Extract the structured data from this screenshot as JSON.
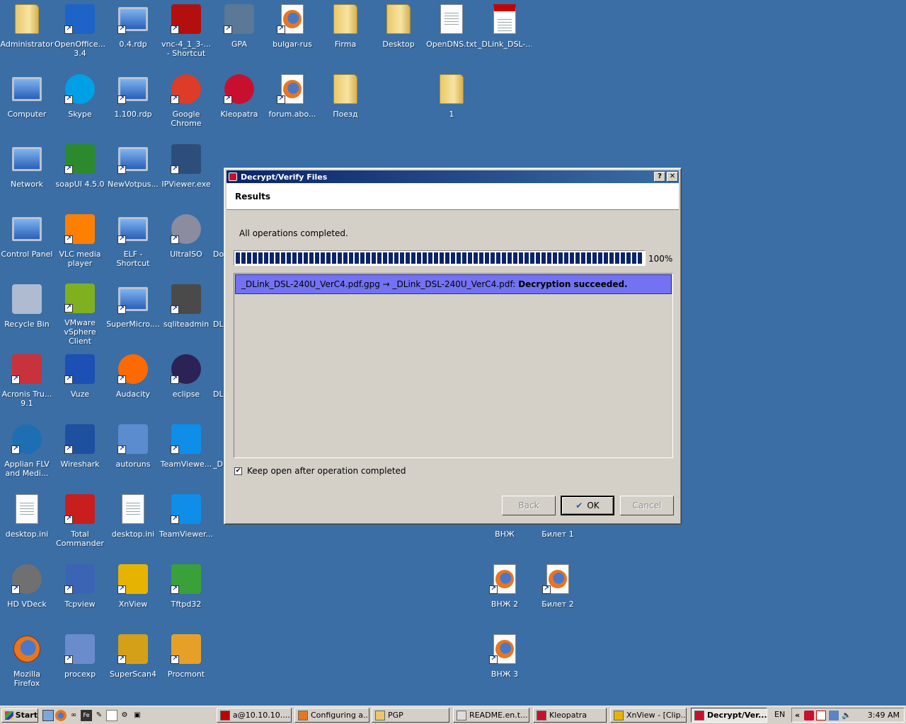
{
  "desktop": {
    "icons": [
      {
        "label": "Administrator",
        "icon": "user-folder-icon",
        "shortcut": false
      },
      {
        "label": "OpenOffice...\n3.4",
        "icon": "openoffice-icon",
        "shortcut": true
      },
      {
        "label": "0.4.rdp",
        "icon": "remote-desktop-icon",
        "shortcut": true
      },
      {
        "label": "vnc-4_1_3-...\n- Shortcut",
        "icon": "vnc-icon",
        "shortcut": true
      },
      {
        "label": "GPA",
        "icon": "gpa-keys-icon",
        "shortcut": true
      },
      {
        "label": "bulgar-rus",
        "icon": "firefox-document-icon",
        "shortcut": true
      },
      {
        "label": "Firma",
        "icon": "folder-icon",
        "shortcut": false
      },
      {
        "label": "Desktop",
        "icon": "folder-warning-icon",
        "shortcut": false
      },
      {
        "label": "OpenDNS.txt",
        "icon": "text-file-icon",
        "shortcut": false
      },
      {
        "label": "_DLink_DSL-...",
        "icon": "pdf-file-icon",
        "shortcut": false
      },
      {
        "label": "Computer",
        "icon": "computer-icon",
        "shortcut": false
      },
      {
        "label": "Skype",
        "icon": "skype-icon",
        "shortcut": true
      },
      {
        "label": "1.100.rdp",
        "icon": "remote-desktop-icon",
        "shortcut": true
      },
      {
        "label": "Google\nChrome",
        "icon": "chrome-icon",
        "shortcut": true
      },
      {
        "label": "Kleopatra",
        "icon": "kleopatra-icon",
        "shortcut": true
      },
      {
        "label": "forum.abo...",
        "icon": "firefox-document-icon",
        "shortcut": true
      },
      {
        "label": "Поезд",
        "icon": "folder-icon",
        "shortcut": false
      },
      {
        "label": "1",
        "icon": "folder-icon",
        "shortcut": false
      },
      {
        "label": "Network",
        "icon": "network-icon",
        "shortcut": false
      },
      {
        "label": "soapUI 4.5.0",
        "icon": "soapui-icon",
        "shortcut": true
      },
      {
        "label": "NewVotpus...",
        "icon": "remote-desktop-icon",
        "shortcut": true
      },
      {
        "label": "IPViewer.exe",
        "icon": "kvm-icon",
        "shortcut": true
      },
      {
        "label": "Control Panel",
        "icon": "control-panel-icon",
        "shortcut": false
      },
      {
        "label": "VLC media\nplayer",
        "icon": "vlc-icon",
        "shortcut": true
      },
      {
        "label": "ELF - Shortcut",
        "icon": "network-computers-icon",
        "shortcut": true
      },
      {
        "label": "UltraISO",
        "icon": "disc-icon",
        "shortcut": true
      },
      {
        "label": "Recycle Bin",
        "icon": "recycle-bin-icon",
        "shortcut": false
      },
      {
        "label": "VMware\nvSphere Client",
        "icon": "vmware-icon",
        "shortcut": true
      },
      {
        "label": "SuperMicro....",
        "icon": "remote-desktop-icon",
        "shortcut": true
      },
      {
        "label": "sqliteadmin",
        "icon": "sqlite-icon",
        "shortcut": true
      },
      {
        "label": "Acronis Tru...\n9.1",
        "icon": "acronis-icon",
        "shortcut": true
      },
      {
        "label": "Vuze",
        "icon": "vuze-icon",
        "shortcut": true
      },
      {
        "label": "Audacity",
        "icon": "audacity-icon",
        "shortcut": true
      },
      {
        "label": "eclipse",
        "icon": "eclipse-icon",
        "shortcut": true
      },
      {
        "label": "Applian FLV\nand Medi...",
        "icon": "applian-icon",
        "shortcut": true
      },
      {
        "label": "Wireshark",
        "icon": "wireshark-icon",
        "shortcut": true
      },
      {
        "label": "autoruns",
        "icon": "autoruns-icon",
        "shortcut": true
      },
      {
        "label": "TeamViewe...",
        "icon": "teamviewer-icon",
        "shortcut": true
      },
      {
        "label": "desktop.ini",
        "icon": "settings-file-icon",
        "shortcut": false
      },
      {
        "label": "Total\nCommander",
        "icon": "total-commander-icon",
        "shortcut": true
      },
      {
        "label": "desktop.ini",
        "icon": "settings-file-icon",
        "shortcut": false
      },
      {
        "label": "TeamViewer...",
        "icon": "teamviewer-icon",
        "shortcut": true
      },
      {
        "label": "HD VDeck",
        "icon": "hd-vdeck-icon",
        "shortcut": true
      },
      {
        "label": "Tcpview",
        "icon": "tcpview-icon",
        "shortcut": true
      },
      {
        "label": "XnView",
        "icon": "xnview-icon",
        "shortcut": true
      },
      {
        "label": "Tftpd32",
        "icon": "tftpd-icon",
        "shortcut": true
      },
      {
        "label": "Mozilla Firefox",
        "icon": "firefox-icon",
        "shortcut": false
      },
      {
        "label": "procexp",
        "icon": "procexp-icon",
        "shortcut": true
      },
      {
        "label": "SuperScan4",
        "icon": "superscan-icon",
        "shortcut": true
      },
      {
        "label": "Procmont",
        "icon": "procmon-icon",
        "shortcut": true
      },
      {
        "label": "ВНЖ",
        "icon": "firefox-document-icon",
        "shortcut": true
      },
      {
        "label": "Билет 1",
        "icon": "firefox-document-icon",
        "shortcut": true
      },
      {
        "label": "ВНЖ 2",
        "icon": "firefox-document-icon",
        "shortcut": true
      },
      {
        "label": "Билет 2",
        "icon": "firefox-document-icon",
        "shortcut": true
      },
      {
        "label": "ВНЖ 3",
        "icon": "firefox-document-icon",
        "shortcut": true
      },
      {
        "label": "Do",
        "icon": "partial-icon",
        "shortcut": false
      },
      {
        "label": "DLi",
        "icon": "partial-icon",
        "shortcut": false
      },
      {
        "label": "DLi",
        "icon": "partial-icon",
        "shortcut": false
      },
      {
        "label": "_DI",
        "icon": "partial-icon",
        "shortcut": false
      }
    ]
  },
  "dialog": {
    "title": "Decrypt/Verify Files",
    "help_button": "?",
    "close_button": "✕",
    "header": "Results",
    "status": "All operations completed.",
    "progress_percent": 100,
    "progress_label": "100%",
    "result": {
      "text": "_DLink_DSL-240U_VerC4.pdf.gpg → _DLink_DSL-240U_VerC4.pdf:",
      "bold": "Decryption succeeded."
    },
    "keep_open": {
      "checked": true,
      "label": "Keep open after operation completed"
    },
    "buttons": {
      "back": "Back",
      "ok": "OK",
      "cancel": "Cancel"
    }
  },
  "taskbar": {
    "start": "Start",
    "tasks": [
      {
        "label": "a@10.10.10....",
        "icon": "filezilla-icon"
      },
      {
        "label": "Configuring a...",
        "icon": "firefox-icon"
      },
      {
        "label": "PGP",
        "icon": "folder-icon"
      },
      {
        "label": "README.en.t...",
        "icon": "notepad-icon"
      },
      {
        "label": "Kleopatra",
        "icon": "kleopatra-icon"
      },
      {
        "label": "XnView - [Clip...",
        "icon": "xnview-icon"
      },
      {
        "label": "Decrypt/Ver...",
        "icon": "kleopatra-icon",
        "active": true
      }
    ],
    "language": "EN",
    "tray_expand": "«",
    "clock": "3:49 AM"
  }
}
